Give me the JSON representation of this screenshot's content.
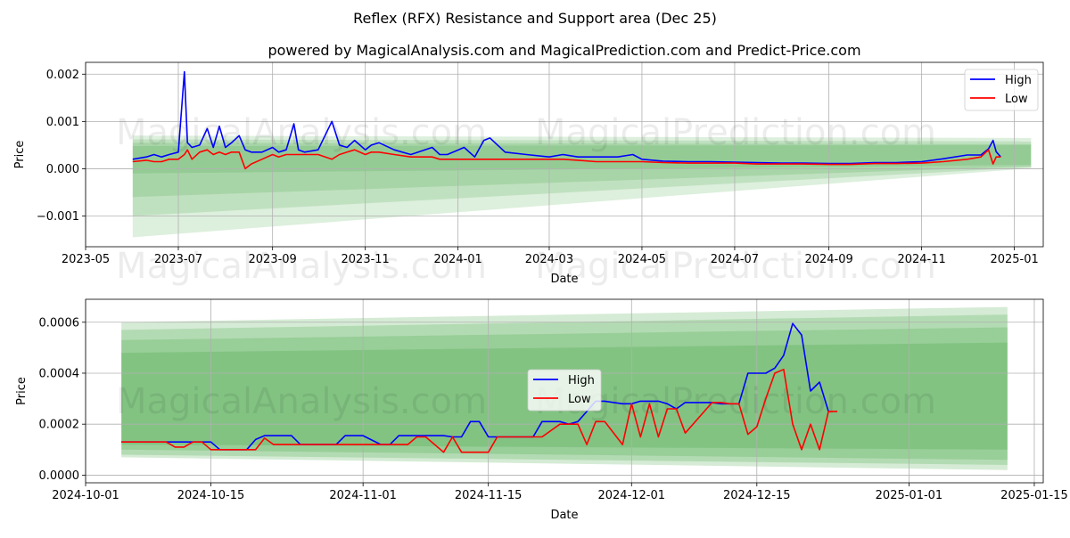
{
  "title": "Reflex (RFX) Resistance and Support area (Dec 25)",
  "subtitle": "powered by MagicalAnalysis.com and MagicalPrediction.com and Predict-Price.com",
  "watermarks": [
    "MagicalAnalysis.com",
    "MagicalPrediction.com"
  ],
  "colors": {
    "high": "#0000ff",
    "low": "#ff0000",
    "band": "#2e9a2e",
    "grid": "#b0b0b0"
  },
  "chart_data": [
    {
      "type": "line",
      "name": "top-chart",
      "xlabel": "Date",
      "ylabel": "Price",
      "grid": true,
      "legend": {
        "position": "top-right",
        "entries": [
          "High",
          "Low"
        ]
      },
      "xlim": [
        "2023-05-01",
        "2025-01-20"
      ],
      "ylim": [
        -0.00165,
        0.00225
      ],
      "x_ticks": [
        "2023-05",
        "2023-07",
        "2023-09",
        "2023-11",
        "2024-01",
        "2024-03",
        "2024-05",
        "2024-07",
        "2024-09",
        "2024-11",
        "2025-01"
      ],
      "x_tick_dates": [
        "2023-05-01",
        "2023-07-01",
        "2023-09-01",
        "2023-11-01",
        "2024-01-01",
        "2024-03-01",
        "2024-05-01",
        "2024-07-01",
        "2024-09-01",
        "2024-11-01",
        "2025-01-01"
      ],
      "y_ticks": [
        -0.001,
        0.0,
        0.001,
        0.002
      ],
      "y_tick_labels": [
        "−0.001",
        "0.000",
        "0.001",
        "0.002"
      ],
      "bands": {
        "start": "2023-06-01",
        "end": "2025-01-12",
        "upper_start": [
          0.0007,
          0.00062,
          0.00055,
          0.00048
        ],
        "lower_start": [
          -0.00145,
          -0.001,
          -0.0006,
          -0.0001
        ],
        "upper_end": [
          0.00065,
          0.00058,
          0.00052,
          0.0005
        ],
        "lower_end": [
          1e-05,
          3e-05,
          5e-05,
          8e-05
        ]
      },
      "series": [
        {
          "name": "High",
          "x": [
            "2023-06-01",
            "2023-06-10",
            "2023-06-15",
            "2023-06-20",
            "2023-06-25",
            "2023-07-01",
            "2023-07-05",
            "2023-07-07",
            "2023-07-10",
            "2023-07-15",
            "2023-07-20",
            "2023-07-24",
            "2023-07-28",
            "2023-08-01",
            "2023-08-05",
            "2023-08-10",
            "2023-08-14",
            "2023-08-18",
            "2023-08-25",
            "2023-09-01",
            "2023-09-05",
            "2023-09-10",
            "2023-09-15",
            "2023-09-18",
            "2023-09-22",
            "2023-10-01",
            "2023-10-10",
            "2023-10-15",
            "2023-10-20",
            "2023-10-25",
            "2023-11-01",
            "2023-11-05",
            "2023-11-10",
            "2023-11-20",
            "2023-12-01",
            "2023-12-15",
            "2023-12-20",
            "2023-12-25",
            "2024-01-05",
            "2024-01-12",
            "2024-01-18",
            "2024-01-22",
            "2024-02-01",
            "2024-02-15",
            "2024-03-01",
            "2024-03-10",
            "2024-03-20",
            "2024-04-01",
            "2024-04-15",
            "2024-04-25",
            "2024-05-01",
            "2024-05-15",
            "2024-06-01",
            "2024-06-15",
            "2024-07-01",
            "2024-07-15",
            "2024-08-01",
            "2024-08-15",
            "2024-09-01",
            "2024-09-15",
            "2024-10-01",
            "2024-10-15",
            "2024-11-01",
            "2024-11-15",
            "2024-12-01",
            "2024-12-10",
            "2024-12-15",
            "2024-12-18",
            "2024-12-20",
            "2024-12-23"
          ],
          "values": [
            0.0002,
            0.00025,
            0.0003,
            0.00025,
            0.0003,
            0.00035,
            0.00205,
            0.00055,
            0.00045,
            0.0005,
            0.00085,
            0.00045,
            0.0009,
            0.00045,
            0.00055,
            0.0007,
            0.0004,
            0.00035,
            0.00035,
            0.00045,
            0.00035,
            0.0004,
            0.00095,
            0.0004,
            0.00035,
            0.0004,
            0.001,
            0.0005,
            0.00045,
            0.0006,
            0.0004,
            0.0005,
            0.00055,
            0.0004,
            0.0003,
            0.00045,
            0.0003,
            0.0003,
            0.00045,
            0.00025,
            0.0006,
            0.00065,
            0.00035,
            0.0003,
            0.00025,
            0.0003,
            0.00025,
            0.00025,
            0.00025,
            0.0003,
            0.0002,
            0.00016,
            0.00015,
            0.00015,
            0.00014,
            0.00013,
            0.00012,
            0.00012,
            0.00011,
            0.00011,
            0.00013,
            0.00013,
            0.00015,
            0.00021,
            0.00029,
            0.00029,
            0.00042,
            0.0006,
            0.00036,
            0.00025
          ]
        },
        {
          "name": "Low",
          "x": [
            "2023-06-01",
            "2023-06-10",
            "2023-06-15",
            "2023-06-20",
            "2023-06-25",
            "2023-07-01",
            "2023-07-05",
            "2023-07-07",
            "2023-07-10",
            "2023-07-15",
            "2023-07-20",
            "2023-07-24",
            "2023-07-28",
            "2023-08-01",
            "2023-08-05",
            "2023-08-10",
            "2023-08-14",
            "2023-08-18",
            "2023-08-25",
            "2023-09-01",
            "2023-09-05",
            "2023-09-10",
            "2023-09-15",
            "2023-09-18",
            "2023-09-22",
            "2023-10-01",
            "2023-10-10",
            "2023-10-15",
            "2023-10-20",
            "2023-10-25",
            "2023-11-01",
            "2023-11-05",
            "2023-11-10",
            "2023-11-20",
            "2023-12-01",
            "2023-12-15",
            "2023-12-20",
            "2023-12-25",
            "2024-01-05",
            "2024-01-12",
            "2024-01-18",
            "2024-01-22",
            "2024-02-01",
            "2024-02-15",
            "2024-03-01",
            "2024-03-10",
            "2024-03-20",
            "2024-04-01",
            "2024-04-15",
            "2024-04-25",
            "2024-05-01",
            "2024-05-15",
            "2024-06-01",
            "2024-06-15",
            "2024-07-01",
            "2024-07-15",
            "2024-08-01",
            "2024-08-15",
            "2024-09-01",
            "2024-09-15",
            "2024-10-01",
            "2024-10-15",
            "2024-11-01",
            "2024-11-15",
            "2024-12-01",
            "2024-12-10",
            "2024-12-15",
            "2024-12-18",
            "2024-12-20",
            "2024-12-23"
          ],
          "values": [
            0.00015,
            0.00018,
            0.00015,
            0.00015,
            0.0002,
            0.0002,
            0.0003,
            0.0004,
            0.0002,
            0.00035,
            0.0004,
            0.0003,
            0.00035,
            0.0003,
            0.00035,
            0.00035,
            0.0,
            0.0001,
            0.0002,
            0.0003,
            0.00025,
            0.0003,
            0.0003,
            0.0003,
            0.0003,
            0.0003,
            0.0002,
            0.0003,
            0.00035,
            0.0004,
            0.0003,
            0.00035,
            0.00035,
            0.0003,
            0.00025,
            0.00025,
            0.0002,
            0.0002,
            0.0002,
            0.0002,
            0.0002,
            0.0002,
            0.0002,
            0.0002,
            0.0002,
            0.0002,
            0.00018,
            0.00015,
            0.00015,
            0.00015,
            0.00015,
            0.00013,
            0.00012,
            0.00012,
            0.00012,
            0.0001,
            0.0001,
            0.0001,
            9e-05,
            9e-05,
            0.00011,
            0.00011,
            0.00012,
            0.00015,
            0.0002,
            0.00025,
            0.0004,
            0.0001,
            0.00025,
            0.00025
          ]
        }
      ]
    },
    {
      "type": "line",
      "name": "bottom-chart",
      "xlabel": "Date",
      "ylabel": "Price",
      "grid": true,
      "legend": {
        "position": "center",
        "entries": [
          "High",
          "Low"
        ]
      },
      "xlim": [
        "2024-10-01",
        "2025-01-16"
      ],
      "ylim": [
        -3e-05,
        0.00069
      ],
      "x_ticks": [
        "2024-10-01",
        "2024-10-15",
        "2024-11-01",
        "2024-11-15",
        "2024-12-01",
        "2024-12-15",
        "2025-01-01",
        "2025-01-15"
      ],
      "y_ticks": [
        0.0,
        0.0002,
        0.0004,
        0.0006
      ],
      "y_tick_labels": [
        "0.0000",
        "0.0002",
        "0.0004",
        "0.0006"
      ],
      "bands": {
        "start": "2024-10-05",
        "end": "2025-01-12",
        "upper_start": [
          0.0006,
          0.00057,
          0.00053,
          0.00048
        ],
        "lower_start": [
          7e-05,
          8e-05,
          0.0001,
          0.00012
        ],
        "upper_end": [
          0.00066,
          0.00063,
          0.00058,
          0.00052
        ],
        "lower_end": [
          2e-05,
          4e-05,
          6e-05,
          0.0001
        ]
      },
      "series": [
        {
          "name": "High",
          "x": [
            "2024-10-05",
            "2024-10-10",
            "2024-10-12",
            "2024-10-14",
            "2024-10-15",
            "2024-10-16",
            "2024-10-19",
            "2024-10-20",
            "2024-10-21",
            "2024-10-22",
            "2024-10-24",
            "2024-10-25",
            "2024-10-29",
            "2024-10-30",
            "2024-11-01",
            "2024-11-03",
            "2024-11-04",
            "2024-11-05",
            "2024-11-06",
            "2024-11-10",
            "2024-11-11",
            "2024-11-12",
            "2024-11-13",
            "2024-11-14",
            "2024-11-15",
            "2024-11-20",
            "2024-11-21",
            "2024-11-23",
            "2024-11-24",
            "2024-11-25",
            "2024-11-26",
            "2024-11-27",
            "2024-11-28",
            "2024-11-30",
            "2024-12-01",
            "2024-12-02",
            "2024-12-03",
            "2024-12-04",
            "2024-12-05",
            "2024-12-06",
            "2024-12-07",
            "2024-12-10",
            "2024-12-11",
            "2024-12-12",
            "2024-12-13",
            "2024-12-14",
            "2024-12-15",
            "2024-12-16",
            "2024-12-17",
            "2024-12-18",
            "2024-12-19",
            "2024-12-20",
            "2024-12-21",
            "2024-12-22",
            "2024-12-23"
          ],
          "values": [
            0.00013,
            0.00013,
            0.00013,
            0.00013,
            0.00013,
            0.0001,
            0.0001,
            0.00014,
            0.000155,
            0.000155,
            0.000155,
            0.00012,
            0.00012,
            0.000155,
            0.000155,
            0.00012,
            0.00012,
            0.000155,
            0.000155,
            0.000155,
            0.00015,
            0.00015,
            0.00021,
            0.00021,
            0.00015,
            0.00015,
            0.00021,
            0.00021,
            0.0002,
            0.00021,
            0.00025,
            0.00029,
            0.00029,
            0.00028,
            0.00028,
            0.00029,
            0.00029,
            0.00029,
            0.00028,
            0.00026,
            0.000285,
            0.000285,
            0.00028,
            0.00028,
            0.00028,
            0.0004,
            0.0004,
            0.0004,
            0.00042,
            0.00047,
            0.000595,
            0.00055,
            0.00033,
            0.000365,
            0.00025
          ]
        },
        {
          "name": "Low",
          "x": [
            "2024-10-05",
            "2024-10-10",
            "2024-10-11",
            "2024-10-12",
            "2024-10-13",
            "2024-10-14",
            "2024-10-15",
            "2024-10-19",
            "2024-10-20",
            "2024-10-21",
            "2024-10-22",
            "2024-10-25",
            "2024-10-30",
            "2024-11-01",
            "2024-11-05",
            "2024-11-06",
            "2024-11-07",
            "2024-11-08",
            "2024-11-09",
            "2024-11-10",
            "2024-11-11",
            "2024-11-12",
            "2024-11-13",
            "2024-11-14",
            "2024-11-15",
            "2024-11-16",
            "2024-11-20",
            "2024-11-21",
            "2024-11-23",
            "2024-11-24",
            "2024-11-25",
            "2024-11-26",
            "2024-11-27",
            "2024-11-28",
            "2024-11-30",
            "2024-12-01",
            "2024-12-02",
            "2024-12-03",
            "2024-12-04",
            "2024-12-05",
            "2024-12-06",
            "2024-12-07",
            "2024-12-10",
            "2024-12-11",
            "2024-12-12",
            "2024-12-13",
            "2024-12-14",
            "2024-12-15",
            "2024-12-16",
            "2024-12-17",
            "2024-12-18",
            "2024-12-19",
            "2024-12-20",
            "2024-12-21",
            "2024-12-22",
            "2024-12-23",
            "2024-12-24"
          ],
          "values": [
            0.00013,
            0.00013,
            0.00011,
            0.00011,
            0.00013,
            0.00013,
            0.0001,
            0.0001,
            0.0001,
            0.000145,
            0.00012,
            0.00012,
            0.00012,
            0.00012,
            0.00012,
            0.00012,
            0.00015,
            0.00015,
            0.00012,
            9e-05,
            0.00015,
            9e-05,
            9e-05,
            9e-05,
            9e-05,
            0.00015,
            0.00015,
            0.00015,
            0.0002,
            0.0002,
            0.0002,
            0.00012,
            0.00021,
            0.00021,
            0.00012,
            0.00028,
            0.00015,
            0.00028,
            0.00015,
            0.00026,
            0.00026,
            0.000165,
            0.000285,
            0.000285,
            0.00028,
            0.00028,
            0.00016,
            0.00019,
            0.0003,
            0.0004,
            0.000415,
            0.0002,
            0.0001,
            0.0002,
            0.0001,
            0.00025,
            0.00025
          ]
        }
      ]
    }
  ]
}
